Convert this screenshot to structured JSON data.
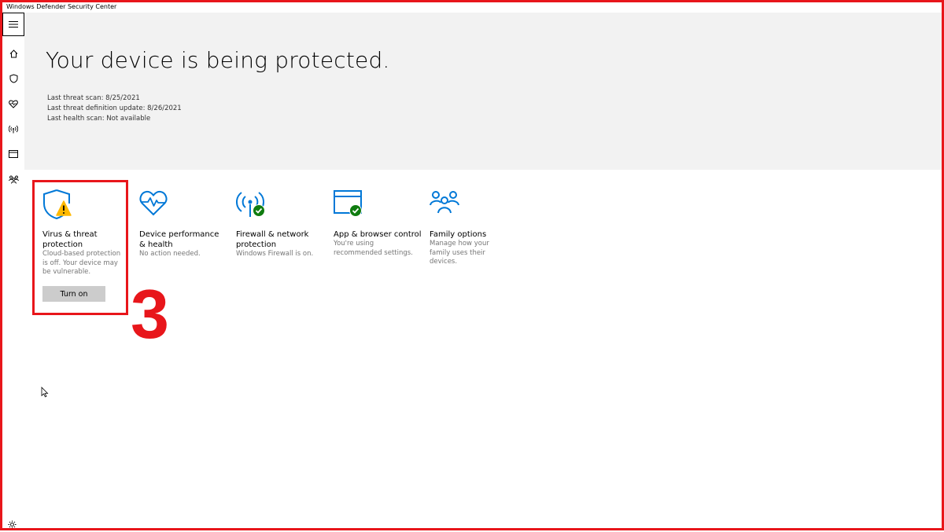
{
  "window": {
    "title": "Windows Defender Security Center"
  },
  "sidebar": {
    "items": [
      {
        "name": "menu",
        "icon": "hamburger-menu-icon"
      },
      {
        "name": "home",
        "icon": "home-icon"
      },
      {
        "name": "virus-protection",
        "icon": "shield-icon"
      },
      {
        "name": "device-health",
        "icon": "heart-pulse-icon"
      },
      {
        "name": "firewall",
        "icon": "antenna-icon"
      },
      {
        "name": "app-browser",
        "icon": "browser-window-icon"
      },
      {
        "name": "family",
        "icon": "family-icon"
      }
    ],
    "settings_icon": "gear-icon"
  },
  "hero": {
    "title": "Your device is being protected.",
    "stats": [
      "Last threat scan:  8/25/2021",
      "Last threat definition update:  8/26/2021",
      "Last health scan:  Not available"
    ]
  },
  "tiles": [
    {
      "title": "Virus & threat protection",
      "desc": "Cloud-based protection is off. Your device may be vulnerable.",
      "status": "warning",
      "button": "Turn on"
    },
    {
      "title": "Device performance & health",
      "desc": "No action needed.",
      "status": "none"
    },
    {
      "title": "Firewall & network protection",
      "desc": "Windows Firewall is on.",
      "status": "ok"
    },
    {
      "title": "App & browser control",
      "desc": "You're using recommended settings.",
      "status": "ok"
    },
    {
      "title": "Family options",
      "desc": "Manage how your family uses their devices.",
      "status": "none"
    }
  ],
  "annotation": {
    "step": "3"
  },
  "colors": {
    "accent": "#0078d7",
    "warning": "#ffb900",
    "ok": "#107c10",
    "annotation": "#e8161b"
  }
}
